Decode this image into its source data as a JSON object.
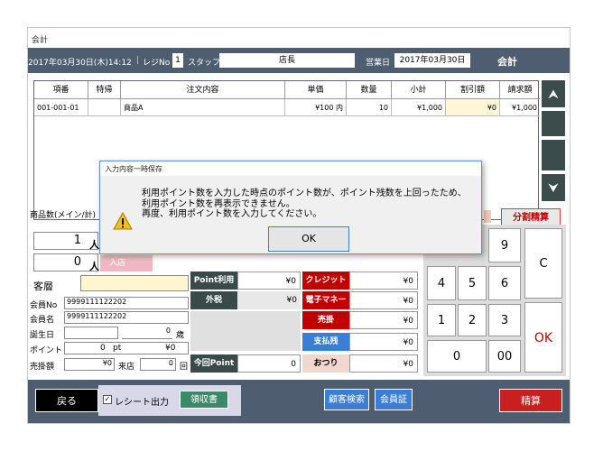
{
  "window_title": "会計",
  "topbar": {
    "datetime": "2017年03月30日(木)14:12",
    "register_label": "レジNo",
    "register_no": "1",
    "staff_label": "スタッフ",
    "staff_name": "店長",
    "business_day_label": "営業日",
    "business_day": "2017年03月30日",
    "screen_name": "会計"
  },
  "grid": {
    "headers": [
      "項番",
      "特帰",
      "注文内容",
      "単価",
      "数量",
      "小計",
      "割引額",
      "請求額"
    ],
    "rows": [
      {
        "no": "001-001-01",
        "special": "",
        "item": "商品A",
        "price": "¥100 内",
        "qty": "10",
        "subtotal": "¥1,000",
        "discount": "¥0",
        "total": "¥1,000"
      }
    ]
  },
  "scroll": {
    "up": "⮝",
    "down": "⮟"
  },
  "product_count_label": "商品数(メイン/計)",
  "split_button": "分割精算",
  "guests": {
    "count1": "1",
    "unit1": "人",
    "count2": "0",
    "unit2": "人",
    "enter_label": "入店"
  },
  "customer": {
    "tier_label": "客層",
    "member_no_label": "会員No",
    "member_no": "9999111122202",
    "member_name_label": "会員名",
    "member_name": "9999111122202",
    "birthday_label": "誕生日",
    "age_unit": "歳",
    "points_label": "ポイント",
    "points": "0",
    "points_unit": "pt",
    "points_yen": "¥0",
    "sales_label": "売掛額",
    "sales": "¥0",
    "visits_label": "来店",
    "visits": "0",
    "visits_unit": "回"
  },
  "payments": {
    "point_use_label": "Point利用",
    "point_use_value": "¥0",
    "tax_label": "外税",
    "tax_value": "¥0",
    "this_point_label": "今回Point",
    "this_point_value": "0",
    "credit_label": "クレジット",
    "credit_value": "¥0",
    "emoney_label": "電子マネー",
    "emoney_value": "¥0",
    "receivable_label": "売掛",
    "receivable_value": "¥0",
    "paid_label": "支払残",
    "paid_value": "¥0",
    "change_label": "おつり",
    "change_value": "¥0"
  },
  "keypad": {
    "k9": "9",
    "c": "C",
    "k4": "4",
    "k5": "5",
    "k6": "6",
    "k1": "1",
    "k2": "2",
    "k3": "3",
    "ok": "OK",
    "k0": "0",
    "k00": "00"
  },
  "bottom": {
    "back": "戻る",
    "receipt_output": "レシート出力",
    "receipt_checked": true,
    "ryoshusho": "領収書",
    "customer_search": "顧客検索",
    "member_card": "会員証",
    "settle": "精算"
  },
  "dialog": {
    "title": "入力内容一時保存",
    "line1": "利用ポイント数を入力した時点のポイント数が、ポイント残数を上回ったため、",
    "line2": "利用ポイント数を再表示できません。",
    "line3": "再度、利用ポイント数を入力してください。",
    "ok": "OK"
  },
  "colors": {
    "header_bg": "#4e5d6f",
    "pay_red": "#c00000",
    "pay_blue": "#3a7fd5",
    "pay_dark": "#3a4a4a",
    "settle_red": "#c82020",
    "accent_green": "#3a8a6a",
    "discount_cell": "#fff6d8"
  }
}
